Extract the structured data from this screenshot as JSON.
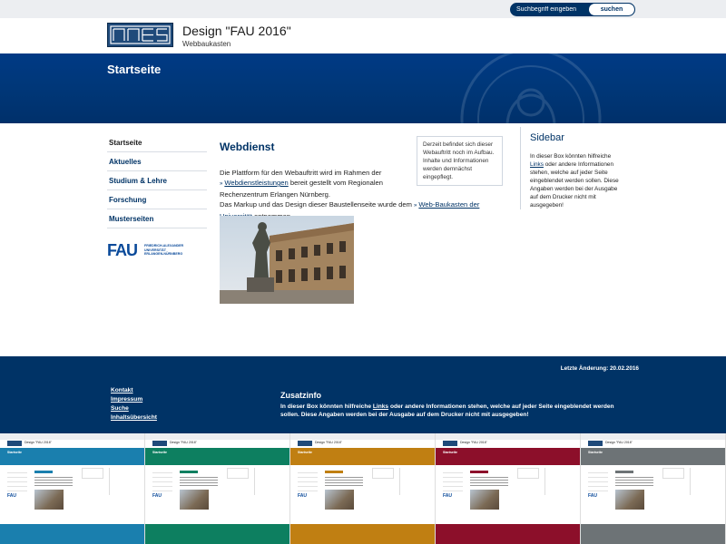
{
  "search": {
    "placeholder": "Suchbegriff eingeben",
    "button_label": "suchen"
  },
  "header": {
    "title": "Design \"FAU 2016\"",
    "subtitle": "Webbaukasten"
  },
  "hero": {
    "title": "Startseite"
  },
  "nav": {
    "items": [
      {
        "label": "Startseite"
      },
      {
        "label": "Aktuelles"
      },
      {
        "label": "Studium & Lehre"
      },
      {
        "label": "Forschung"
      },
      {
        "label": "Musterseiten"
      }
    ]
  },
  "fau_logo": {
    "mark": "FAU",
    "line1": "FRIEDRICH-ALEXANDER",
    "line2": "UNIVERSITÄT",
    "line3": "ERLANGEN-NÜRNBERG"
  },
  "main": {
    "heading": "Webdienst",
    "p1_before": "Die Plattform für den Webauftritt wird im Rahmen der",
    "link1": "Webdienstleistungen",
    "p1_after": "bereit gestellt vom Regionalen Rechenzentrum Erlangen Nürnberg.",
    "p2_before": "Das Markup und das Design dieser Baustellenseite wurde dem",
    "link2": "Web-Baukasten der Universität",
    "p2_after": "entnommen."
  },
  "infobox": {
    "text": "Derzeit befindet sich dieser Webauftritt noch im Aufbau. Inhalte und Informationen werden demnächst eingepflegt."
  },
  "sidebar": {
    "title": "Sidebar",
    "text_before": "In dieser Box könnten hilfreiche",
    "link": "Links",
    "text_after": "oder andere Informationen stehen, welche auf jeder Seite eingeblendet werden sollen. Diese Angaben werden bei der Ausgabe auf dem Drucker nicht mit ausgegeben!"
  },
  "footer": {
    "last_modified": "Letzte Änderung: 20.02.2016",
    "links": [
      {
        "label": "Kontakt"
      },
      {
        "label": "Impressum"
      },
      {
        "label": "Suche"
      },
      {
        "label": "Inhaltsübersicht"
      }
    ],
    "zusatz_title": "Zusatzinfo",
    "zusatz_before": "In dieser Box könnten hilfreiche",
    "zusatz_link": "Links",
    "zusatz_after": "oder  andere Informationen stehen, welche auf jeder Seite eingeblendet werden sollen. Diese Angaben werden bei der Ausgabe auf dem Drucker nicht mit ausgegeben!"
  },
  "colors": {
    "brand": "#003366",
    "hero": "#003778",
    "variants": [
      "#1a7fae",
      "#0d7f60",
      "#c07f12",
      "#8c0f2a",
      "#6d7376"
    ]
  },
  "thumbnails": [
    {
      "title": "Design \"FAU 2016\"",
      "hero": "Startseite",
      "fau": "FAU"
    },
    {
      "title": "Design \"FAU 2016\"",
      "hero": "Startseite",
      "fau": "FAU"
    },
    {
      "title": "Design \"FAU 2016\"",
      "hero": "Startseite",
      "fau": "FAU"
    },
    {
      "title": "Design \"FAU 2016\"",
      "hero": "Startseite",
      "fau": "FAU"
    },
    {
      "title": "Design \"FAU 2016\"",
      "hero": "Startseite",
      "fau": "FAU"
    }
  ]
}
